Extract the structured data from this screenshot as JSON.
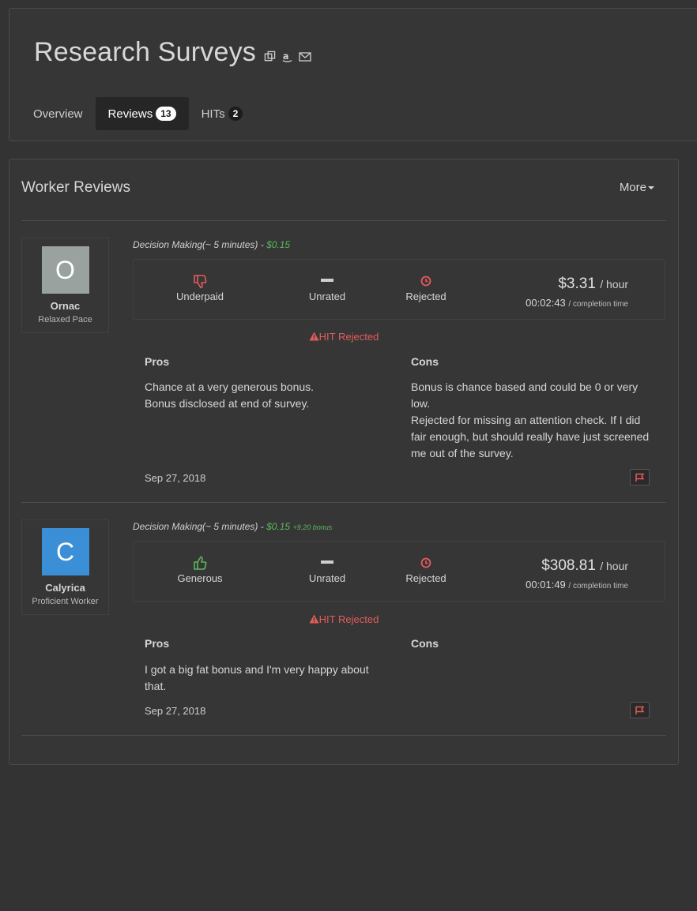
{
  "header": {
    "title": "Research Surveys",
    "icons": [
      "copy-icon",
      "amazon-icon",
      "mail-icon"
    ],
    "tabs": [
      {
        "label": "Overview",
        "count": null,
        "active": false
      },
      {
        "label": "Reviews",
        "count": "13",
        "active": true
      },
      {
        "label": "HITs",
        "count": "2",
        "active": false
      }
    ]
  },
  "reviews_panel": {
    "title": "Worker Reviews",
    "more_label": "More"
  },
  "reviews": [
    {
      "user_initial": "O",
      "user_name": "Ornac",
      "user_type": "Relaxed Pace",
      "avatar_color": "#9aa2a0",
      "hit_title": "Decision Making(~ 5 minutes)",
      "hit_sep": " - ",
      "hit_pay": "$0.15",
      "hit_bonus": "",
      "pay_label": "Underpaid",
      "comm_label": "Unrated",
      "approval_label": "Rejected",
      "hourly": "$3.31",
      "hourly_unit": "/ hour",
      "completion": "00:02:43",
      "completion_unit": "/ completion time",
      "status": "HIT Rejected",
      "pros_label": "Pros",
      "cons_label": "Cons",
      "pros": "Chance at a very generous bonus.\nBonus disclosed at end of survey.",
      "cons": "Bonus is chance based and could be 0 or very low.\nRejected for missing an attention check. If I did fair enough, but should really have just screened me out of the survey.",
      "date": "Sep 27, 2018"
    },
    {
      "user_initial": "C",
      "user_name": "Calyrica",
      "user_type": "Proficient Worker",
      "avatar_color": "#3a8fd6",
      "hit_title": "Decision Making(~ 5 minutes)",
      "hit_sep": " - ",
      "hit_pay": "$0.15",
      "hit_bonus": "+9.20 bonus",
      "pay_label": "Generous",
      "comm_label": "Unrated",
      "approval_label": "Rejected",
      "hourly": "$308.81",
      "hourly_unit": "/ hour",
      "completion": "00:01:49",
      "completion_unit": "/ completion time",
      "status": "HIT Rejected",
      "pros_label": "Pros",
      "cons_label": "Cons",
      "pros": "I got a big fat bonus and I'm very happy about that.",
      "cons": "",
      "date": "Sep 27, 2018"
    }
  ],
  "colors": {
    "accent_green": "#5cb85c",
    "accent_red": "#e45c5a",
    "background": "#333333"
  }
}
